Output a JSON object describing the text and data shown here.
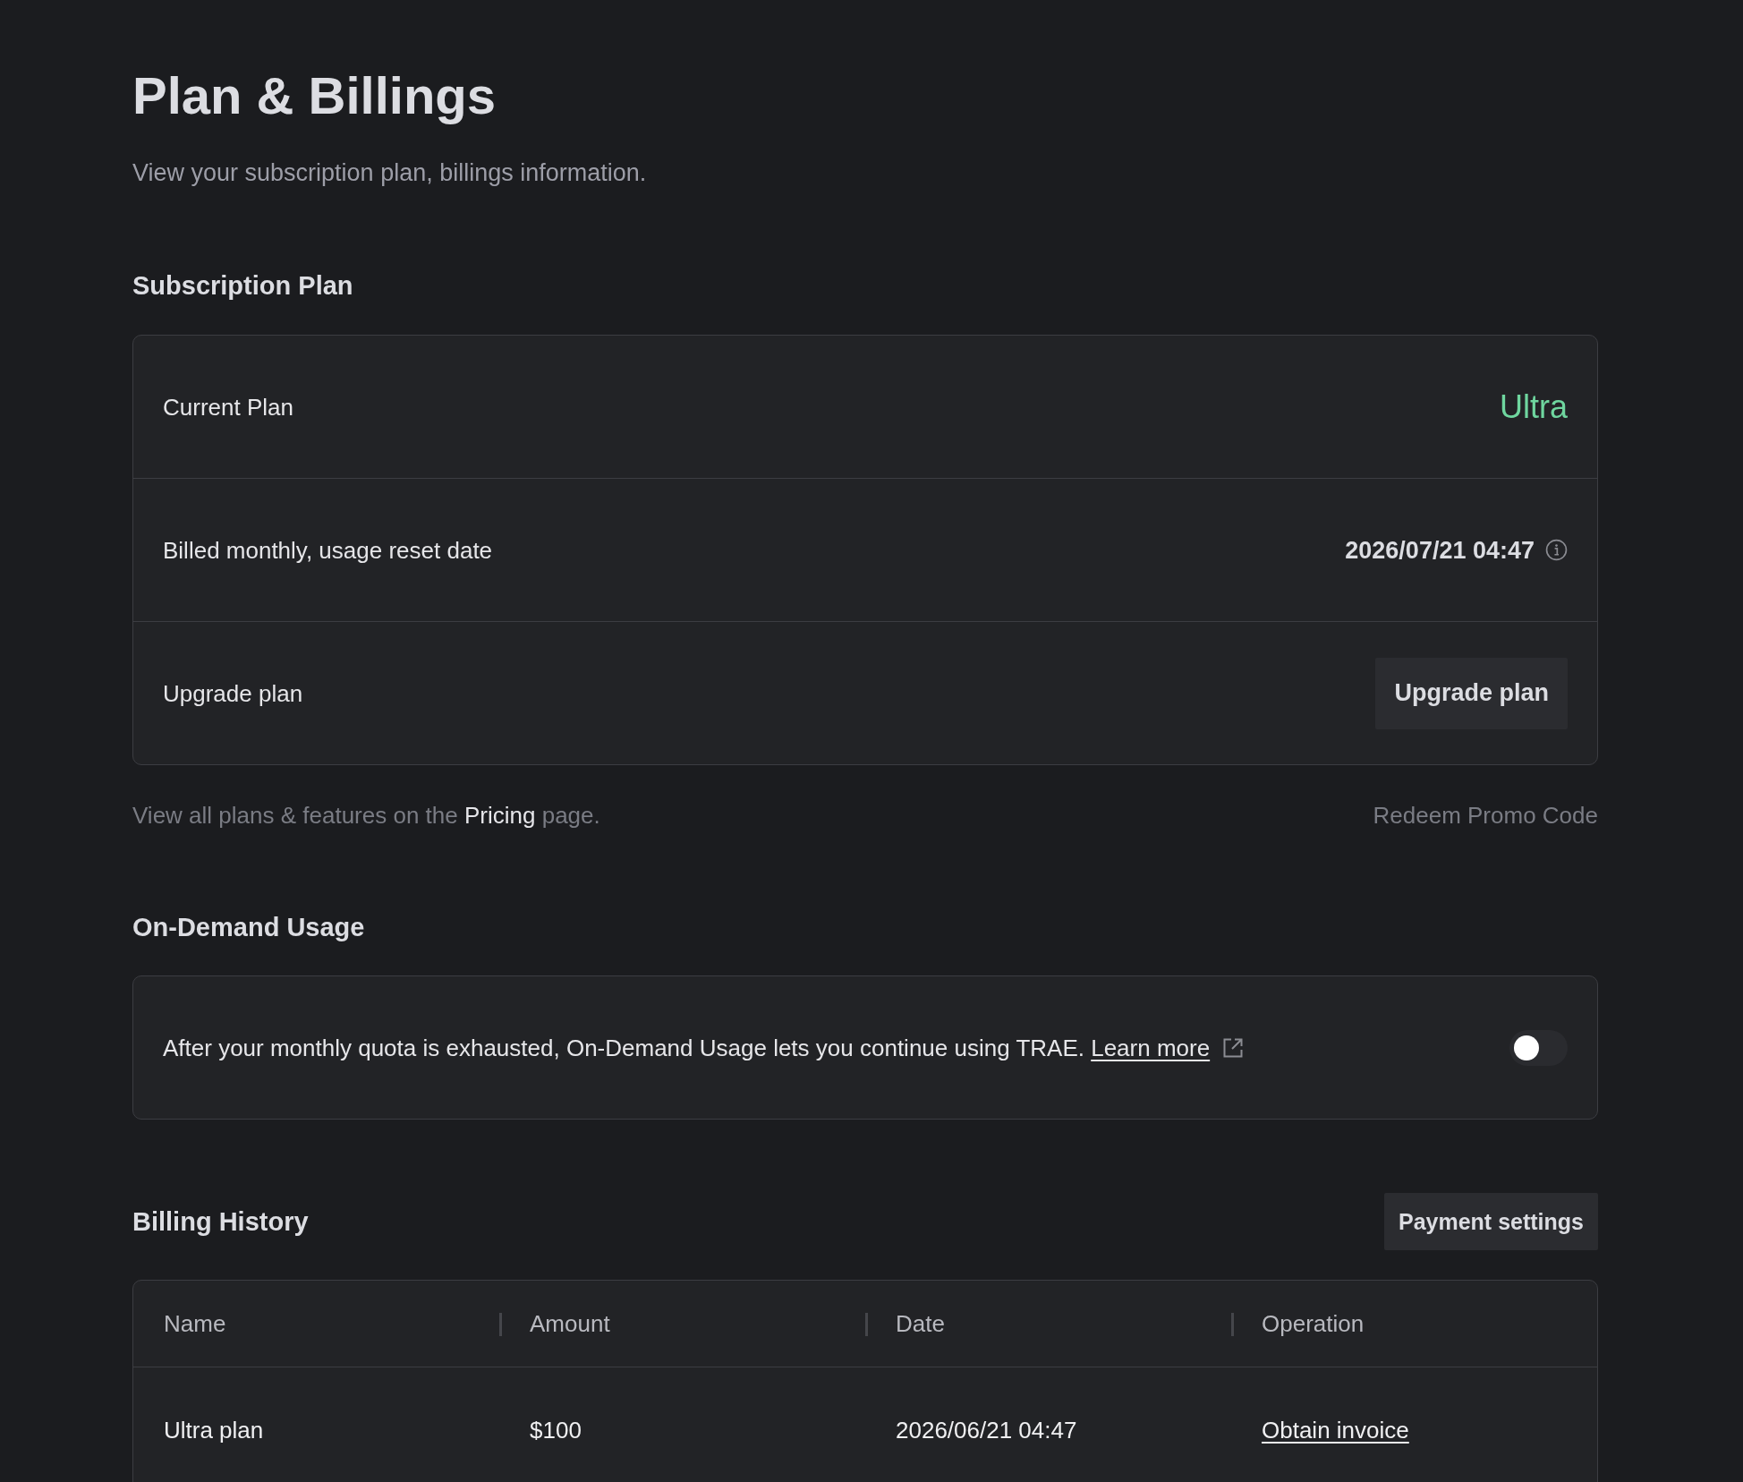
{
  "page": {
    "title": "Plan & Billings",
    "subtitle": "View your subscription plan, billings information."
  },
  "subscription_plan": {
    "heading": "Subscription Plan",
    "rows": [
      {
        "kind": "plan",
        "label": "Current Plan",
        "value": "Ultra"
      },
      {
        "kind": "date",
        "label": "Billed monthly, usage reset date",
        "value": "2026/07/21 04:47"
      },
      {
        "kind": "action",
        "label": "Upgrade plan",
        "value": "Upgrade plan"
      }
    ],
    "note": {
      "before": "View all plans & features on the",
      "link": "Pricing",
      "after": "page."
    },
    "redeem_link": "Redeem Promo Code"
  },
  "on_demand_usage": {
    "heading": "On-Demand Usage",
    "description": "After your monthly quota is exhausted, On-Demand Usage lets you continue using TRAE.",
    "link": "Learn more",
    "on": false
  },
  "billing_history": {
    "heading": "Billing History",
    "button": "Payment settings",
    "columns": [
      "Name",
      "Amount",
      "Date",
      "Operation"
    ],
    "rows": [
      {
        "name": "Ultra plan",
        "amount": "$100",
        "date": "2026/06/21 04:47",
        "operation": "Obtain invoice"
      }
    ]
  }
}
